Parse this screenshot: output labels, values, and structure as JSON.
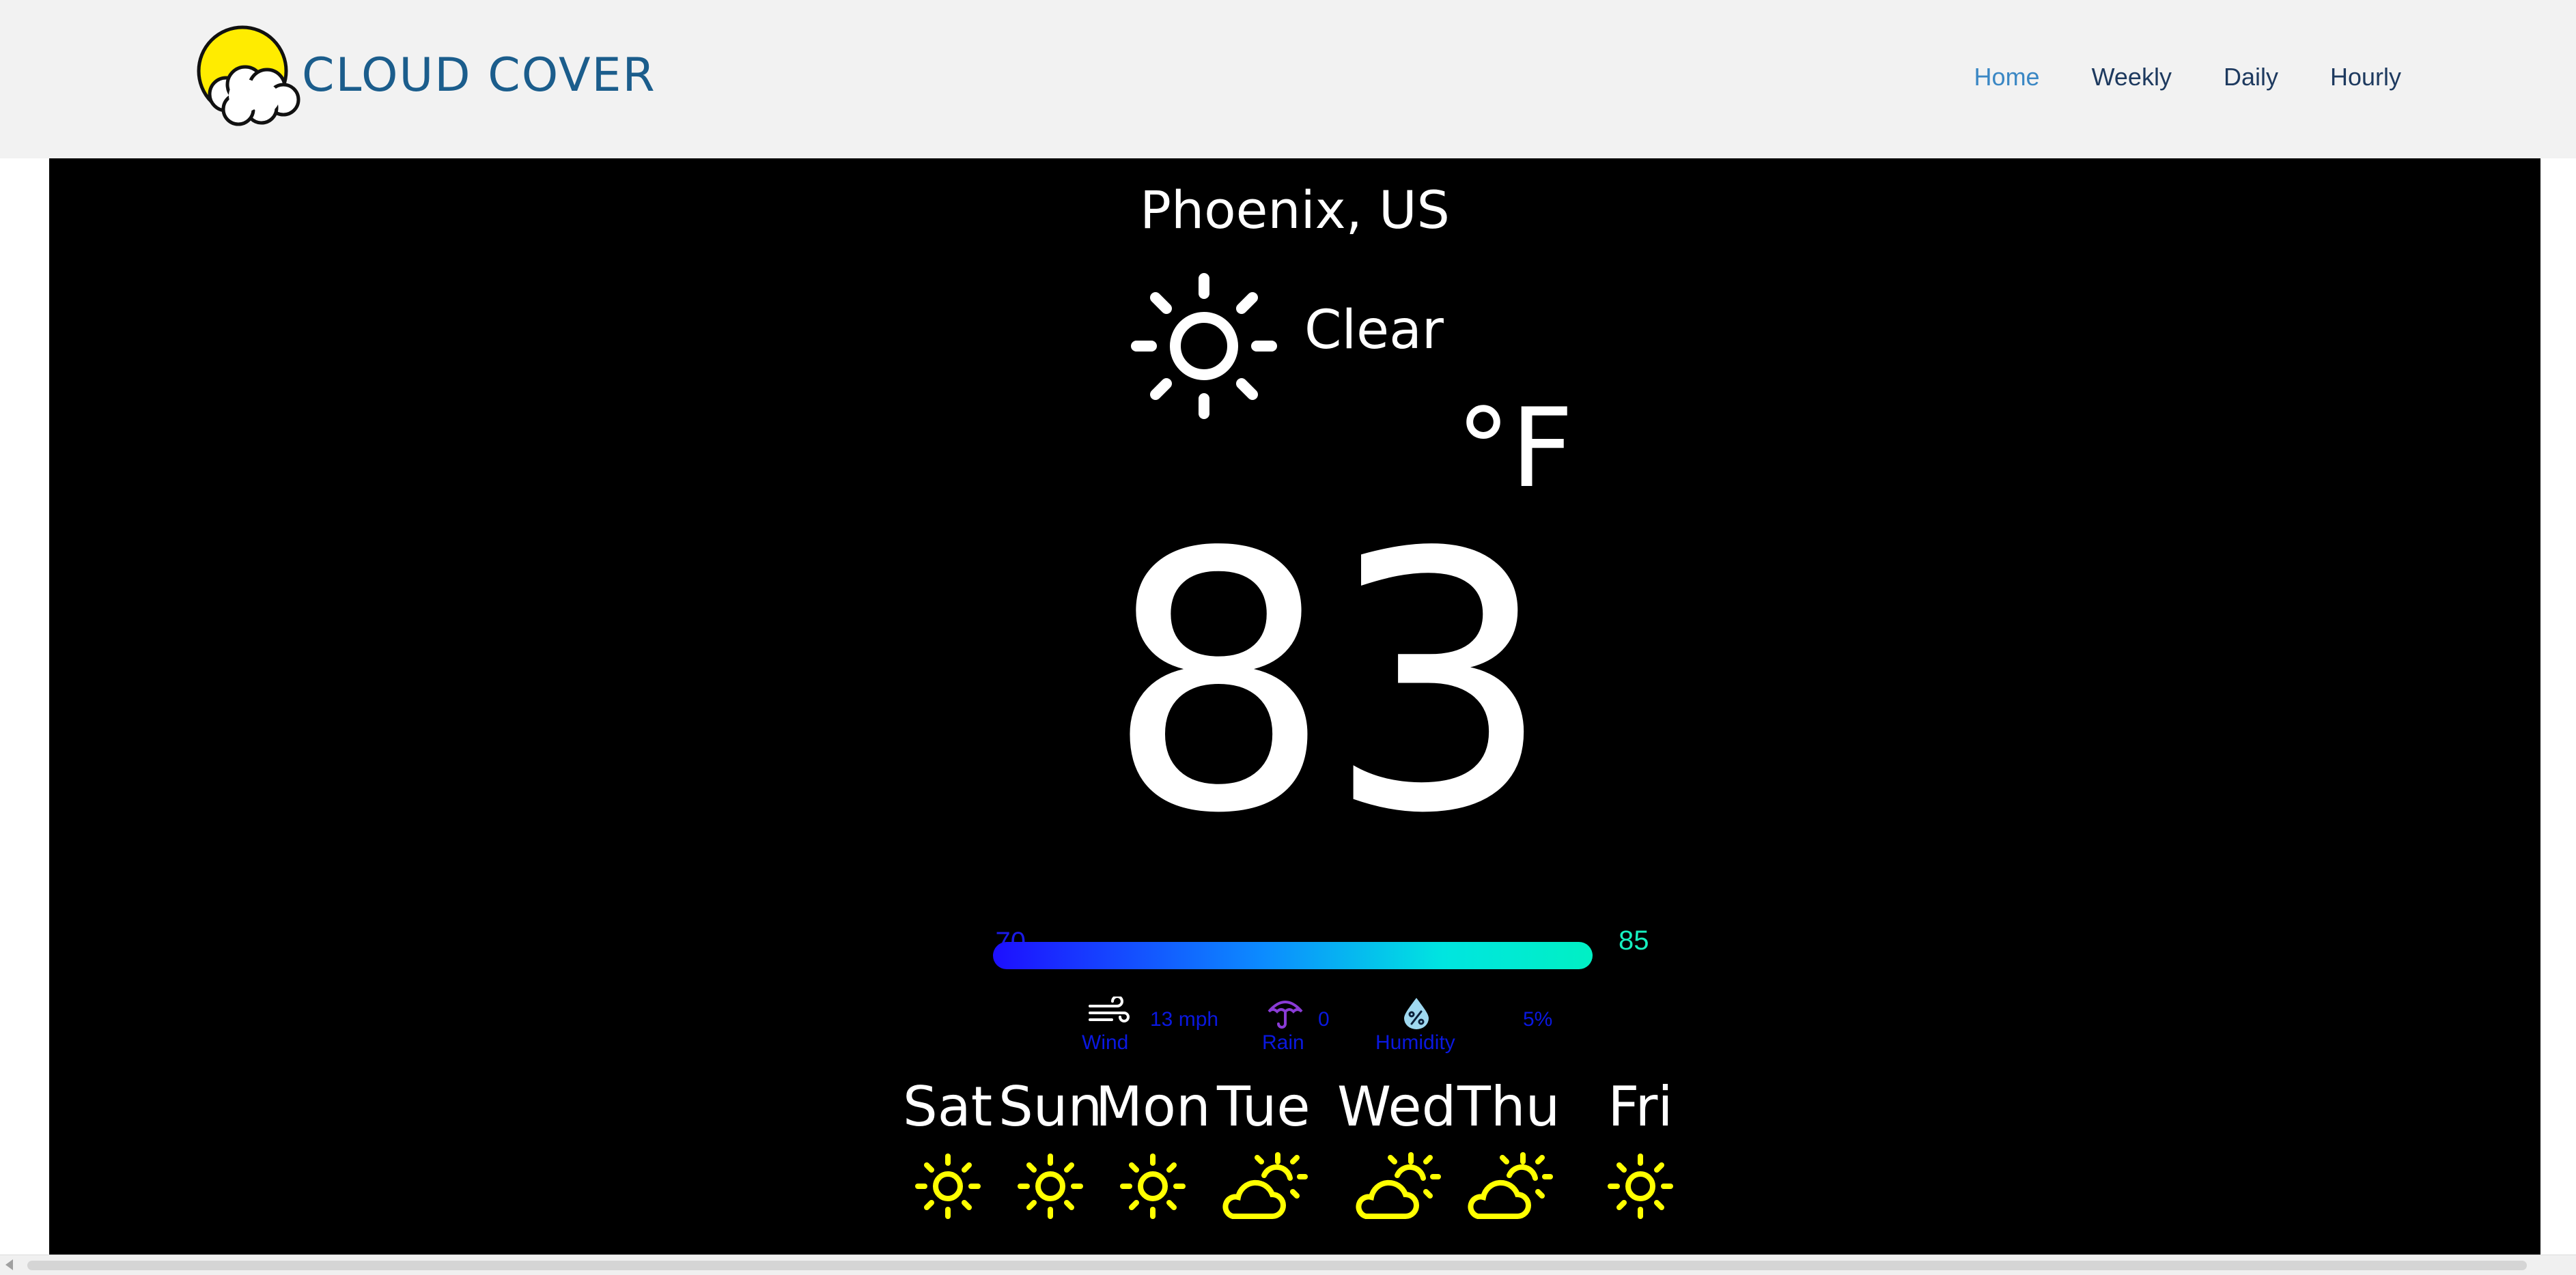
{
  "header": {
    "brand": "CLOUD COVER",
    "nav": [
      {
        "label": "Home",
        "active": true
      },
      {
        "label": "Weekly",
        "active": false
      },
      {
        "label": "Daily",
        "active": false
      },
      {
        "label": "Hourly",
        "active": false
      }
    ]
  },
  "weather": {
    "location": "Phoenix, US",
    "condition": "Clear",
    "condition_icon": "sun-icon",
    "unit": "°F",
    "temperature": "83",
    "range": {
      "low": "70",
      "high": "85",
      "low_color": "#1a1ae6",
      "high_color": "#16f0c0"
    },
    "stats": {
      "wind": {
        "label": "Wind",
        "value": "13 mph",
        "icon": "wind-icon"
      },
      "rain": {
        "label": "Rain",
        "value": "0",
        "icon": "umbrella-icon"
      },
      "humidity": {
        "label": "Humidity",
        "value": "5%",
        "icon": "humidity-drop-icon"
      }
    }
  },
  "forecast": [
    {
      "day": "Sat",
      "icon": "sun-icon"
    },
    {
      "day": "Sun",
      "icon": "sun-icon"
    },
    {
      "day": "Mon",
      "icon": "sun-icon"
    },
    {
      "day": "Tue",
      "icon": "partly-cloudy-icon"
    },
    {
      "day": "Wed",
      "icon": "partly-cloudy-icon"
    },
    {
      "day": "Thu",
      "icon": "partly-cloudy-icon"
    },
    {
      "day": "Fri",
      "icon": "sun-icon"
    }
  ],
  "colors": {
    "header_bg": "#f2f2f2",
    "brand": "#1b5d8c",
    "nav_active": "#3a87c4",
    "nav": "#1e3a5f",
    "panel_bg": "#000000",
    "forecast_icon": "#ffff00",
    "stat_text": "#0a18e0",
    "umbrella": "#8a3bd6",
    "humidity_drop": "#9fd8f0"
  }
}
